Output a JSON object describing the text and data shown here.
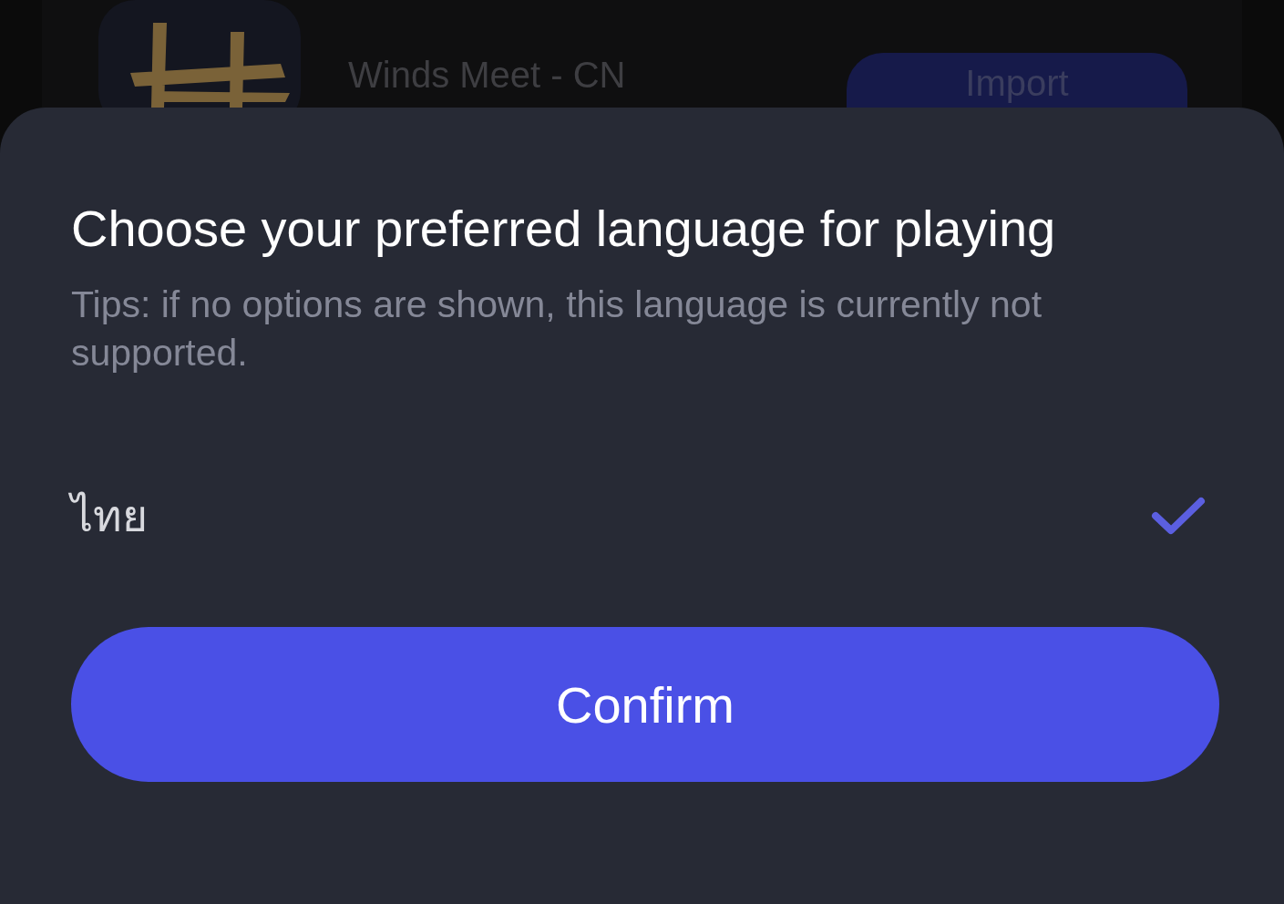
{
  "background_app": {
    "name": "Winds Meet - CN",
    "button": "Import"
  },
  "sheet": {
    "title": "Choose your preferred language for playing",
    "tips": "Tips: if no options are shown, this language is currently not supported.",
    "options": [
      {
        "label": "ไทย",
        "selected": true
      }
    ],
    "confirm": "Confirm"
  }
}
